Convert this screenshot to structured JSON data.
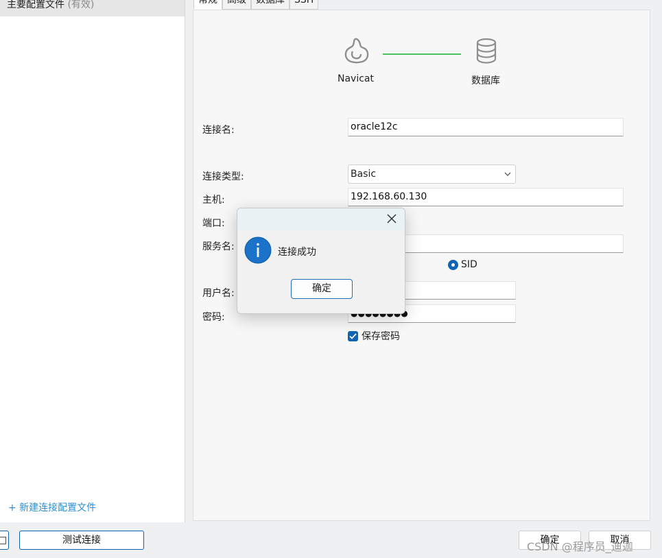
{
  "sidebar": {
    "profile_name": "主要配置文件",
    "profile_status": "(有效)",
    "new_profile_link": "+ 新建连接配置文件"
  },
  "tabs": [
    {
      "label": "常规"
    },
    {
      "label": "高级"
    },
    {
      "label": "数据库"
    },
    {
      "label": "SSH"
    }
  ],
  "diagram": {
    "left_label": "Navicat",
    "right_label": "数据库",
    "line_color": "#4cc35a"
  },
  "form": {
    "connection_name_label": "连接名:",
    "connection_name_value": "oracle12c",
    "connection_type_label": "连接类型:",
    "connection_type_value": "Basic",
    "host_label": "主机:",
    "host_value": "192.168.60.130",
    "port_label": "端口:",
    "service_label": "服务名:",
    "sid_label": "SID",
    "username_label": "用户名:",
    "password_label": "密码:",
    "password_mask": "●●●●●●●●",
    "save_password_label": "保存密码"
  },
  "dialog": {
    "message": "连接成功",
    "ok_label": "确定"
  },
  "buttons": {
    "left_edge_label": "□",
    "test_connection": "测试连接",
    "ok": "确定",
    "cancel": "取消"
  },
  "watermark": "CSDN @程序员_迪迦",
  "colors": {
    "accent": "#0f64b4",
    "info_icon": "#1a73c8"
  }
}
